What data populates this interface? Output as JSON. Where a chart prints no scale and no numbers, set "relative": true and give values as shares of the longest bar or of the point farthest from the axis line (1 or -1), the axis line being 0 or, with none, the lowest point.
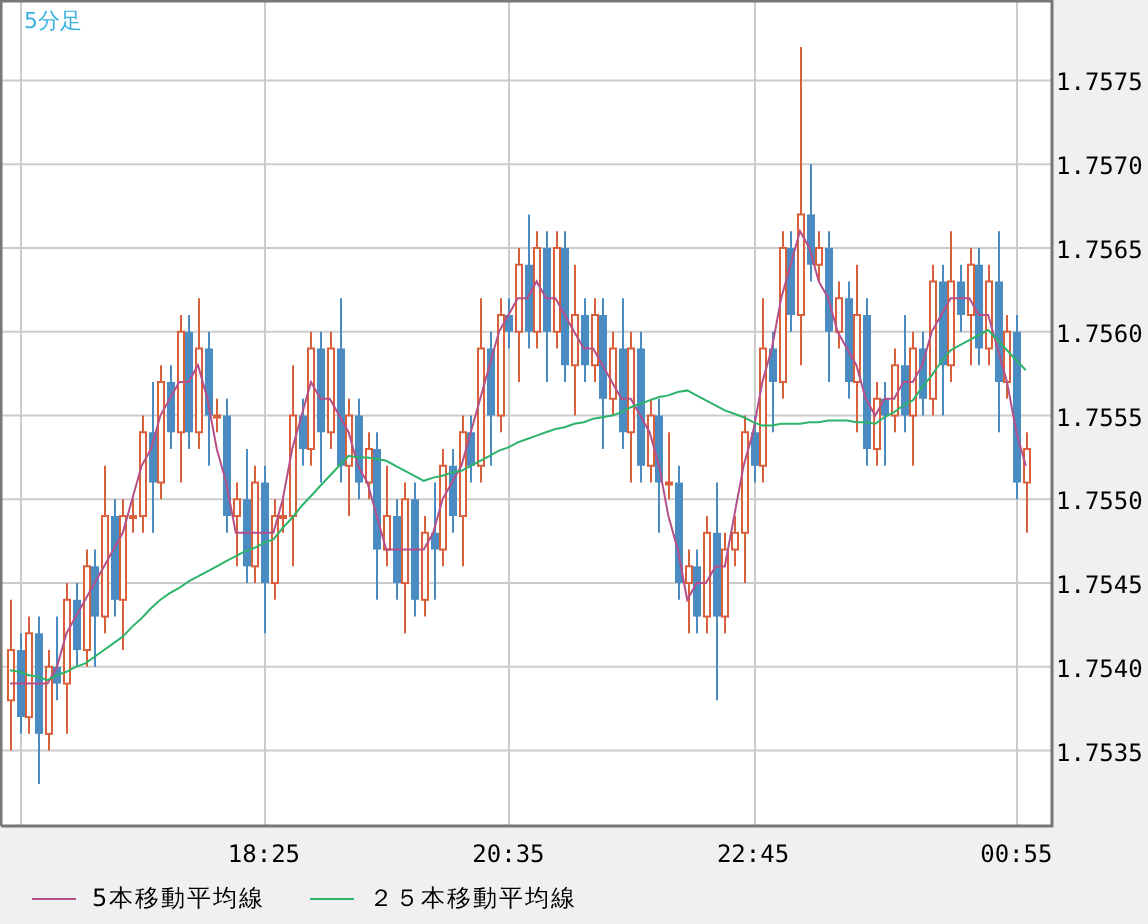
{
  "chart": {
    "title": "5分足",
    "chart_data": {
      "type": "candlestick",
      "categories": [
        null,
        null,
        null,
        null,
        null,
        null,
        null,
        null,
        null,
        null,
        null,
        null,
        null,
        null,
        null,
        null,
        null,
        null,
        null,
        null,
        null,
        null,
        null,
        null,
        null,
        null,
        null,
        "18:25",
        null,
        null,
        null,
        null,
        null,
        null,
        null,
        null,
        null,
        null,
        null,
        null,
        null,
        null,
        null,
        null,
        null,
        null,
        null,
        null,
        null,
        null,
        null,
        null,
        null,
        "20:35",
        null,
        null,
        null,
        null,
        null,
        null,
        null,
        null,
        null,
        null,
        null,
        null,
        null,
        null,
        null,
        null,
        null,
        null,
        null,
        null,
        null,
        null,
        null,
        null,
        null,
        "22:45",
        null,
        null,
        null,
        null,
        null,
        null,
        null,
        null,
        null,
        null,
        null,
        null,
        null,
        null,
        null,
        null,
        null,
        null,
        null,
        null,
        null,
        null,
        null,
        null,
        null,
        null,
        null,
        "00:55",
        null
      ],
      "ohlc": [
        [
          1.7538,
          1.7544,
          1.7535,
          1.7541
        ],
        [
          1.7541,
          1.7542,
          1.7536,
          1.7537
        ],
        [
          1.7537,
          1.7543,
          1.7536,
          1.7542
        ],
        [
          1.7542,
          1.7543,
          1.7533,
          1.7536
        ],
        [
          1.7536,
          1.7541,
          1.7535,
          1.754
        ],
        [
          1.754,
          1.7543,
          1.7538,
          1.7539
        ],
        [
          1.7539,
          1.7545,
          1.7536,
          1.7544
        ],
        [
          1.7544,
          1.7545,
          1.754,
          1.7541
        ],
        [
          1.7541,
          1.7547,
          1.754,
          1.7546
        ],
        [
          1.7546,
          1.7547,
          1.754,
          1.7543
        ],
        [
          1.7543,
          1.7552,
          1.7542,
          1.7549
        ],
        [
          1.7549,
          1.755,
          1.7543,
          1.7544
        ],
        [
          1.7544,
          1.755,
          1.7541,
          1.7549
        ],
        [
          1.7549,
          1.755,
          1.7548,
          1.7549
        ],
        [
          1.7549,
          1.7555,
          1.7548,
          1.7554
        ],
        [
          1.7554,
          1.7557,
          1.7548,
          1.7551
        ],
        [
          1.7551,
          1.7558,
          1.755,
          1.7557
        ],
        [
          1.7557,
          1.7558,
          1.7553,
          1.7554
        ],
        [
          1.7554,
          1.7561,
          1.7551,
          1.756
        ],
        [
          1.756,
          1.7561,
          1.7553,
          1.7554
        ],
        [
          1.7554,
          1.7562,
          1.7553,
          1.7559
        ],
        [
          1.7559,
          1.756,
          1.7552,
          1.7555
        ],
        [
          1.7555,
          1.7556,
          1.7554,
          1.7555
        ],
        [
          1.7555,
          1.7556,
          1.7548,
          1.7549
        ],
        [
          1.7549,
          1.7551,
          1.7546,
          1.755
        ],
        [
          1.755,
          1.7553,
          1.7545,
          1.7546
        ],
        [
          1.7546,
          1.7552,
          1.7545,
          1.7551
        ],
        [
          1.7551,
          1.7552,
          1.7542,
          1.7545
        ],
        [
          1.7545,
          1.755,
          1.7544,
          1.7549
        ],
        [
          1.7549,
          1.755,
          1.7548,
          1.7549
        ],
        [
          1.7549,
          1.7558,
          1.7546,
          1.7555
        ],
        [
          1.7555,
          1.7556,
          1.7552,
          1.7553
        ],
        [
          1.7553,
          1.756,
          1.7552,
          1.7559
        ],
        [
          1.7559,
          1.756,
          1.7551,
          1.7554
        ],
        [
          1.7554,
          1.756,
          1.7553,
          1.7559
        ],
        [
          1.7559,
          1.7562,
          1.7551,
          1.7552
        ],
        [
          1.7552,
          1.7556,
          1.7549,
          1.7555
        ],
        [
          1.7555,
          1.7556,
          1.755,
          1.7551
        ],
        [
          1.7551,
          1.7554,
          1.755,
          1.7553
        ],
        [
          1.7553,
          1.7554,
          1.7544,
          1.7547
        ],
        [
          1.7547,
          1.7552,
          1.7546,
          1.7549
        ],
        [
          1.7549,
          1.755,
          1.7544,
          1.7545
        ],
        [
          1.7545,
          1.7551,
          1.7542,
          1.755
        ],
        [
          1.755,
          1.7551,
          1.7543,
          1.7544
        ],
        [
          1.7544,
          1.7549,
          1.7543,
          1.7548
        ],
        [
          1.7548,
          1.7551,
          1.7544,
          1.7547
        ],
        [
          1.7547,
          1.7553,
          1.7546,
          1.7552
        ],
        [
          1.7552,
          1.7553,
          1.7548,
          1.7549
        ],
        [
          1.7549,
          1.7555,
          1.7546,
          1.7554
        ],
        [
          1.7554,
          1.7555,
          1.7551,
          1.7552
        ],
        [
          1.7552,
          1.7562,
          1.7551,
          1.7559
        ],
        [
          1.7559,
          1.756,
          1.7552,
          1.7555
        ],
        [
          1.7555,
          1.7562,
          1.7554,
          1.7561
        ],
        [
          1.7561,
          1.7562,
          1.7559,
          1.756
        ],
        [
          1.756,
          1.7565,
          1.7557,
          1.7564
        ],
        [
          1.7564,
          1.7567,
          1.7559,
          1.756
        ],
        [
          1.756,
          1.7566,
          1.7559,
          1.7565
        ],
        [
          1.7565,
          1.7566,
          1.7557,
          1.756
        ],
        [
          1.756,
          1.7566,
          1.7559,
          1.7565
        ],
        [
          1.7565,
          1.7566,
          1.7557,
          1.7558
        ],
        [
          1.7558,
          1.7564,
          1.7555,
          1.7561
        ],
        [
          1.7561,
          1.7562,
          1.7557,
          1.7558
        ],
        [
          1.7558,
          1.7562,
          1.7557,
          1.7561
        ],
        [
          1.7561,
          1.7562,
          1.7553,
          1.7556
        ],
        [
          1.7556,
          1.756,
          1.7555,
          1.7559
        ],
        [
          1.7559,
          1.7562,
          1.7553,
          1.7554
        ],
        [
          1.7554,
          1.756,
          1.7551,
          1.7559
        ],
        [
          1.7559,
          1.756,
          1.7551,
          1.7552
        ],
        [
          1.7552,
          1.7556,
          1.7551,
          1.7555
        ],
        [
          1.7555,
          1.7556,
          1.7548,
          1.7551
        ],
        [
          1.7551,
          1.7554,
          1.755,
          1.7551
        ],
        [
          1.7551,
          1.7552,
          1.7544,
          1.7545
        ],
        [
          1.7545,
          1.7547,
          1.7542,
          1.7546
        ],
        [
          1.7546,
          1.7547,
          1.7542,
          1.7543
        ],
        [
          1.7543,
          1.7549,
          1.7542,
          1.7548
        ],
        [
          1.7548,
          1.7551,
          1.7538,
          1.7543
        ],
        [
          1.7543,
          1.7548,
          1.7542,
          1.7547
        ],
        [
          1.7547,
          1.7549,
          1.7546,
          1.7548
        ],
        [
          1.7548,
          1.7555,
          1.7545,
          1.7554
        ],
        [
          1.7554,
          1.7555,
          1.7551,
          1.7552
        ],
        [
          1.7552,
          1.7562,
          1.7551,
          1.7559
        ],
        [
          1.7559,
          1.756,
          1.7554,
          1.7557
        ],
        [
          1.7557,
          1.7566,
          1.7556,
          1.7565
        ],
        [
          1.7565,
          1.7566,
          1.756,
          1.7561
        ],
        [
          1.7561,
          1.7577,
          1.7558,
          1.7567
        ],
        [
          1.7567,
          1.757,
          1.7563,
          1.7564
        ],
        [
          1.7564,
          1.7566,
          1.7563,
          1.7565
        ],
        [
          1.7565,
          1.7566,
          1.7557,
          1.756
        ],
        [
          1.756,
          1.7563,
          1.7559,
          1.7562
        ],
        [
          1.7562,
          1.7563,
          1.7556,
          1.7557
        ],
        [
          1.7557,
          1.7564,
          1.7554,
          1.7561
        ],
        [
          1.7561,
          1.7562,
          1.7552,
          1.7553
        ],
        [
          1.7553,
          1.7557,
          1.7552,
          1.7556
        ],
        [
          1.7556,
          1.7557,
          1.7552,
          1.7555
        ],
        [
          1.7555,
          1.7559,
          1.7554,
          1.7558
        ],
        [
          1.7558,
          1.7561,
          1.7554,
          1.7555
        ],
        [
          1.7555,
          1.756,
          1.7552,
          1.7559
        ],
        [
          1.7559,
          1.756,
          1.7555,
          1.7556
        ],
        [
          1.7556,
          1.7564,
          1.7555,
          1.7563
        ],
        [
          1.7563,
          1.7564,
          1.7555,
          1.7558
        ],
        [
          1.7558,
          1.7566,
          1.7557,
          1.7563
        ],
        [
          1.7563,
          1.7564,
          1.756,
          1.7561
        ],
        [
          1.7561,
          1.7565,
          1.7558,
          1.7564
        ],
        [
          1.7564,
          1.7565,
          1.7558,
          1.7559
        ],
        [
          1.7559,
          1.7564,
          1.7558,
          1.7563
        ],
        [
          1.7563,
          1.7566,
          1.7554,
          1.7557
        ],
        [
          1.7557,
          1.7561,
          1.7556,
          1.756
        ],
        [
          1.756,
          1.7561,
          1.755,
          1.7551
        ],
        [
          1.7551,
          1.7554,
          1.7548,
          1.7553
        ]
      ],
      "grid": true,
      "ylim": [
        1.75305,
        1.75798
      ],
      "yticks": [
        {
          "value": 1.7575,
          "label": "1.7575"
        },
        {
          "value": 1.757,
          "label": "1.7570"
        },
        {
          "value": 1.7565,
          "label": "1.7565"
        },
        {
          "value": 1.756,
          "label": "1.7560"
        },
        {
          "value": 1.7555,
          "label": "1.7555"
        },
        {
          "value": 1.755,
          "label": "1.7550"
        },
        {
          "value": 1.7545,
          "label": "1.7545"
        },
        {
          "value": 1.754,
          "label": "1.7540"
        },
        {
          "value": 1.7535,
          "label": "1.7535"
        }
      ]
    }
  },
  "moving_averages": {
    "chart_data": {
      "type": "line",
      "relative": true,
      "ylim": [
        1.75305,
        1.75798
      ],
      "series": [
        {
          "name": "5本移動平均線",
          "color": "#b5508a",
          "values": [
            1.7539,
            1.7539,
            1.7539,
            1.7539,
            1.7539,
            1.754,
            1.7542,
            1.7543,
            1.7544,
            1.7545,
            1.7546,
            1.7547,
            1.7548,
            1.755,
            1.7552,
            1.7553,
            1.7555,
            1.7556,
            1.7557,
            1.7557,
            1.7558,
            1.7556,
            1.7553,
            1.7551,
            1.7548,
            1.7548,
            1.7548,
            1.7548,
            1.7548,
            1.755,
            1.7553,
            1.7555,
            1.7557,
            1.7556,
            1.7556,
            1.7555,
            1.7554,
            1.7552,
            1.7551,
            1.7549,
            1.7547,
            1.7547,
            1.7547,
            1.7547,
            1.7547,
            1.7548,
            1.755,
            1.7551,
            1.7552,
            1.7554,
            1.7556,
            1.7558,
            1.756,
            1.7561,
            1.7562,
            1.7562,
            1.7563,
            1.7562,
            1.7562,
            1.7561,
            1.756,
            1.7559,
            1.7559,
            1.7558,
            1.7557,
            1.7556,
            1.7556,
            1.7555,
            1.7554,
            1.7552,
            1.7549,
            1.7547,
            1.7544,
            1.7545,
            1.7545,
            1.7546,
            1.7546,
            1.7549,
            1.7552,
            1.7554,
            1.7557,
            1.7559,
            1.7562,
            1.7564,
            1.7566,
            1.7565,
            1.7563,
            1.7562,
            1.756,
            1.7559,
            1.7558,
            1.7556,
            1.7555,
            1.7556,
            1.7556,
            1.7557,
            1.7557,
            1.7558,
            1.756,
            1.7561,
            1.7562,
            1.7562,
            1.7562,
            1.7561,
            1.7561,
            1.7559,
            1.7557,
            1.7554,
            1.7552
          ]
        },
        {
          "name": "２５本移動平均線",
          "color": "#2db36a",
          "values": [
            1.75398,
            1.75397,
            1.75395,
            1.75394,
            1.75392,
            1.75395,
            1.75397,
            1.754,
            1.75402,
            1.75406,
            1.7541,
            1.75414,
            1.75418,
            1.75424,
            1.75429,
            1.75435,
            1.7544,
            1.75444,
            1.75447,
            1.75451,
            1.75454,
            1.75457,
            1.7546,
            1.75463,
            1.75466,
            1.75469,
            1.75471,
            1.75474,
            1.75476,
            1.75483,
            1.75489,
            1.75496,
            1.75502,
            1.75508,
            1.75514,
            1.7552,
            1.75526,
            1.75525,
            1.75525,
            1.75524,
            1.75523,
            1.7552,
            1.75517,
            1.75514,
            1.75511,
            1.75513,
            1.75514,
            1.75516,
            1.75517,
            1.7552,
            1.75523,
            1.75526,
            1.75529,
            1.75531,
            1.75534,
            1.75536,
            1.75538,
            1.7554,
            1.75542,
            1.75543,
            1.75545,
            1.75546,
            1.75548,
            1.75549,
            1.7555,
            1.75552,
            1.75555,
            1.75557,
            1.75559,
            1.75561,
            1.75562,
            1.75564,
            1.75565,
            1.75562,
            1.75559,
            1.75556,
            1.75553,
            1.75551,
            1.75549,
            1.75546,
            1.75544,
            1.75544,
            1.75545,
            1.75545,
            1.75545,
            1.75546,
            1.75546,
            1.75547,
            1.75547,
            1.75547,
            1.75546,
            1.75546,
            1.75545,
            1.75549,
            1.75552,
            1.75556,
            1.75559,
            1.75567,
            1.75574,
            1.75582,
            1.75589,
            1.75592,
            1.75595,
            1.75598,
            1.75601,
            1.75595,
            1.75589,
            1.75583,
            1.75577
          ]
        }
      ]
    }
  }
}
